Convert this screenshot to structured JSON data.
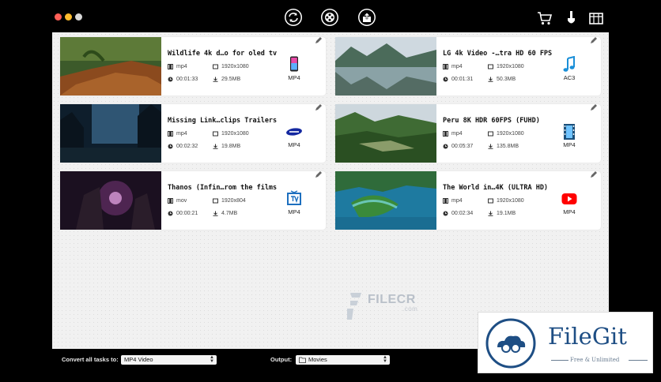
{
  "toolbar": {
    "convert_icon": "convert-refresh-icon",
    "reel_icon": "film-reel-icon",
    "share_icon": "share-icon",
    "cart_icon": "cart-icon",
    "brush_icon": "brush-icon",
    "toolbox_icon": "toolbox-icon"
  },
  "videos": [
    {
      "title": "Wildlife 4k d…o for oled tv",
      "format": "mp4",
      "resolution": "1920x1080",
      "duration": "00:01:33",
      "size": "29.5MB",
      "target": "MP4",
      "target_icon": "iphone-icon"
    },
    {
      "title": "LG 4k Video -…tra HD 60 FPS",
      "format": "mp4",
      "resolution": "1920x1080",
      "duration": "00:01:31",
      "size": "50.3MB",
      "target": "AC3",
      "target_icon": "music-note-icon"
    },
    {
      "title": "Missing Link…clips Trailers",
      "format": "mp4",
      "resolution": "1920x1080",
      "duration": "00:02:32",
      "size": "19.8MB",
      "target": "MP4",
      "target_icon": "samsung-logo-icon"
    },
    {
      "title": "Peru 8K HDR 60FPS (FUHD)",
      "format": "mp4",
      "resolution": "1920x1080",
      "duration": "00:05:37",
      "size": "135.8MB",
      "target": "MP4",
      "target_icon": "film-strip-icon"
    },
    {
      "title": "Thanos (Infin…rom the films",
      "format": "mov",
      "resolution": "1920x804",
      "duration": "00:00:21",
      "size": "4.7MB",
      "target": "MP4",
      "target_icon": "tv-icon"
    },
    {
      "title": "The World in…4K (ULTRA HD)",
      "format": "mp4",
      "resolution": "1920x1080",
      "duration": "00:02:34",
      "size": "19.1MB",
      "target": "MP4",
      "target_icon": "youtube-icon"
    }
  ],
  "watermark": {
    "text": "FILECR",
    "suffix": ".com"
  },
  "bottom": {
    "convert_label": "Convert all tasks to:",
    "convert_value": "MP4 Video",
    "output_label": "Output:",
    "output_value": "Movies"
  },
  "overlay": {
    "name": "FileGit",
    "tagline": "Free & Unlimited"
  },
  "colors": {
    "accent_blue": "#1e4e84",
    "youtube_red": "#ff0000",
    "traffic_red": "#ff5f57",
    "traffic_yellow": "#febc2e"
  }
}
